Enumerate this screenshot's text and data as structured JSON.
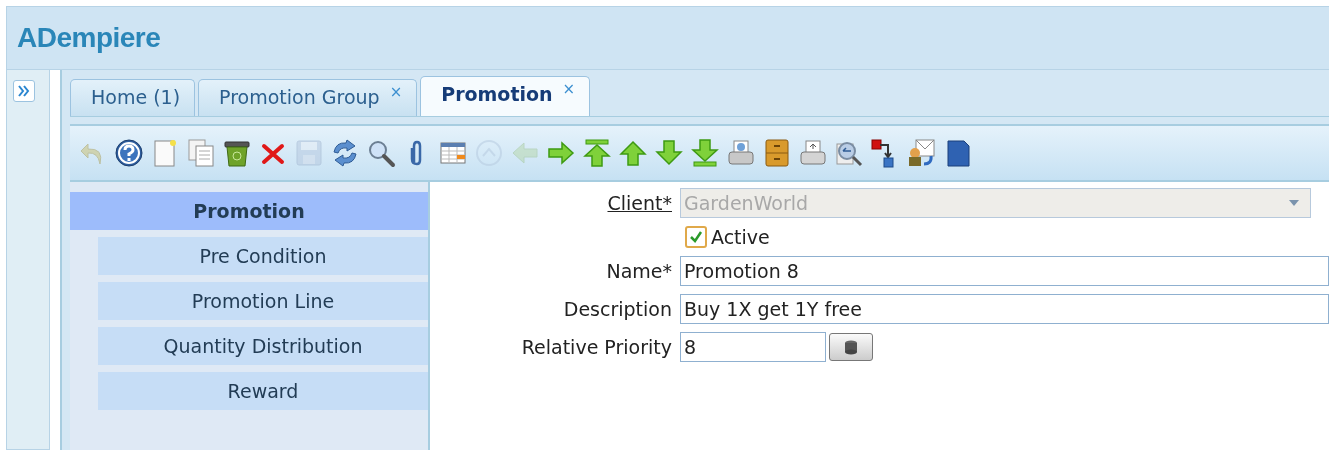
{
  "app": {
    "logo": "ADempiere"
  },
  "tabs": [
    {
      "label": "Home (1)",
      "selected": false
    },
    {
      "label": "Promotion Group",
      "selected": false,
      "close": "×"
    },
    {
      "label": "Promotion",
      "selected": true,
      "close": "×"
    }
  ],
  "toolbar": [
    {
      "kind": "undo",
      "disabled": true
    },
    {
      "kind": "help",
      "disabled": false
    },
    {
      "kind": "new",
      "disabled": false
    },
    {
      "kind": "copy",
      "disabled": false
    },
    {
      "kind": "trash",
      "disabled": false
    },
    {
      "kind": "delete",
      "disabled": false
    },
    {
      "kind": "save",
      "disabled": true
    },
    {
      "kind": "refresh",
      "disabled": false
    },
    {
      "kind": "search",
      "disabled": false
    },
    {
      "kind": "attach",
      "disabled": false
    },
    {
      "kind": "grid",
      "disabled": false
    },
    {
      "kind": "history",
      "disabled": true
    },
    {
      "kind": "back",
      "disabled": true
    },
    {
      "kind": "forward",
      "disabled": false
    },
    {
      "kind": "first",
      "disabled": false
    },
    {
      "kind": "up",
      "disabled": false
    },
    {
      "kind": "down",
      "disabled": false
    },
    {
      "kind": "last",
      "disabled": false
    },
    {
      "kind": "report",
      "disabled": false
    },
    {
      "kind": "archive",
      "disabled": false
    },
    {
      "kind": "print",
      "disabled": false
    },
    {
      "kind": "zoom",
      "disabled": false
    },
    {
      "kind": "workflow",
      "disabled": false
    },
    {
      "kind": "request",
      "disabled": false
    },
    {
      "kind": "product",
      "disabled": false
    }
  ],
  "detail_tabs": [
    {
      "label": "Promotion",
      "selected": true,
      "children": [
        {
          "label": "Pre Condition",
          "selected": false
        },
        {
          "label": "Promotion Line",
          "selected": false
        },
        {
          "label": "Quantity Distribution",
          "selected": false
        },
        {
          "label": "Reward",
          "selected": false
        }
      ]
    }
  ],
  "fields": [
    {
      "kind": "select",
      "label": "Client*",
      "value": "GardenWorld",
      "disabled": true
    },
    {
      "kind": "checkbox",
      "label": "Active",
      "checked": true
    },
    {
      "kind": "text",
      "label": "Name*",
      "value": "Promotion 8"
    },
    {
      "kind": "text",
      "label": "Description",
      "value": "Buy 1X get 1Y free"
    },
    {
      "kind": "number",
      "label": "Relative Priority",
      "value": "8"
    }
  ]
}
